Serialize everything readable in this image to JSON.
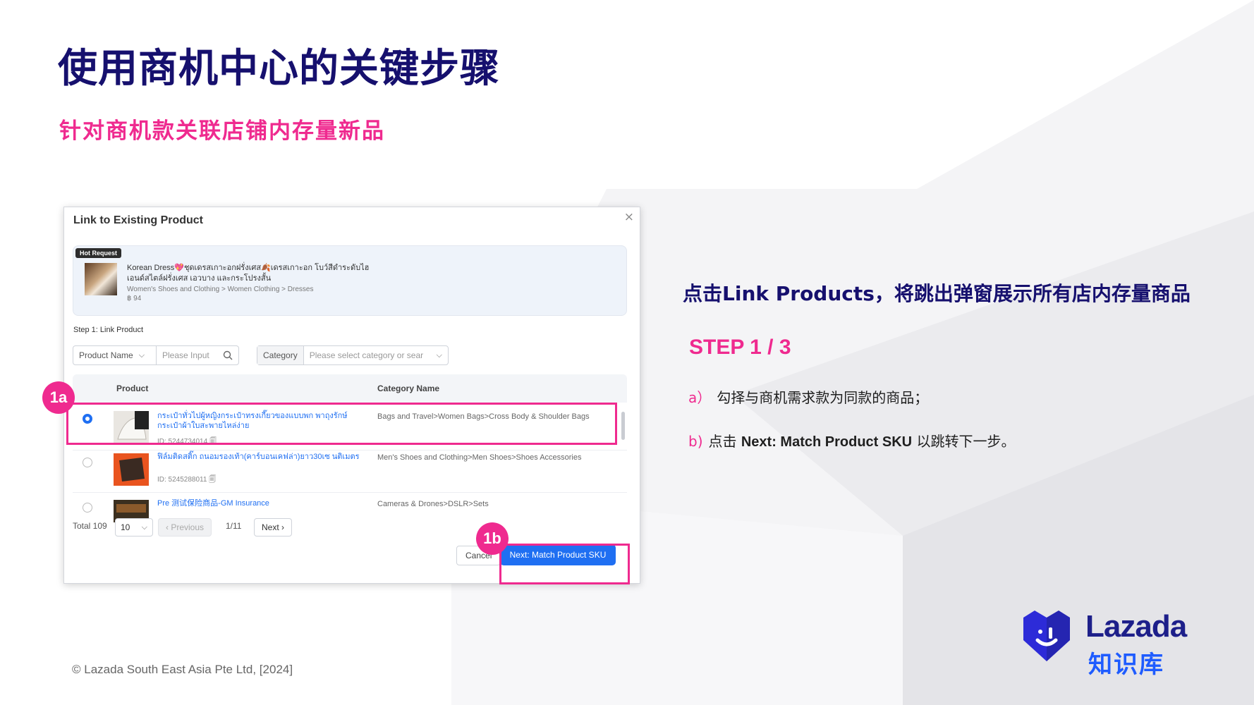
{
  "slide": {
    "title": "使用商机中心的关键步骤",
    "subtitle": "针对商机款关联店铺内存量新品",
    "footer": "© Lazada South East Asia Pte Ltd, [2024]"
  },
  "dialog": {
    "title": "Link to Existing Product",
    "close_icon": "×",
    "hot_request": {
      "badge": "Hot Request",
      "name": "Korean Dress💖ชุดเดรสเกาะอกฝรั่งเศส🍂เดรสเกาะอก โบว์สีดำระดับไฮเอนด์สไตล์ฝรั่งเศส เอวบาง และกระโปรงสั้น",
      "category": "Women's Shoes and Clothing > Women Clothing > Dresses",
      "price": "฿ 94"
    },
    "step_label": "Step 1: Link Product",
    "filters": {
      "field_select": "Product Name",
      "search_placeholder": "Please Input",
      "category_label": "Category",
      "category_placeholder": "Please select category or sear"
    },
    "table": {
      "headers": [
        "Product",
        "Category Name"
      ],
      "rows": [
        {
          "selected": true,
          "name": "กระเป๋าทั่วไปผู้หญิงกระเป๋าทรงเกี๊ยวของแบบพก พาถุงรักษ์กระเป๋าผ้าใบสะพายไหล่ง่าย",
          "id": "ID: 5244734014 🗐",
          "category": "Bags and Travel>Women Bags>Cross Body & Shoulder Bags"
        },
        {
          "selected": false,
          "name": "ฟิล์มติดสติ๊ก ถนอมรองเท้า(คาร์บอนเคฟล่า)ยาว30เซ นติเมตร",
          "id": "ID: 5245288011 🗐",
          "category": "Men's Shoes and Clothing>Men Shoes>Shoes Accessories"
        },
        {
          "selected": false,
          "name": "Pre 测试保险商品-GM Insurance",
          "id": "",
          "category": "Cameras & Drones>DSLR>Sets"
        }
      ]
    },
    "pagination": {
      "total": "Total 109",
      "page_size": "10",
      "previous": "‹ Previous",
      "page_indicator": "1/11",
      "next": "Next ›"
    },
    "cancel_label": "Cancel",
    "next_label": "Next: Match Product SKU"
  },
  "markers": {
    "a": "1a",
    "b": "1b"
  },
  "instructions": {
    "heading": "点击Link Products，将跳出弹窗展示所有店内存量商品",
    "step": "STEP 1 / 3",
    "item_a_label": "a）",
    "item_a_text": "勾择与商机需求款为同款的商品；",
    "item_b_label": "b)",
    "item_b_pre": "点击 ",
    "item_b_bold": "Next: Match Product SKU",
    "item_b_post": " 以跳转下一步。"
  },
  "logo": {
    "word": "Lazada",
    "sub": "知识库"
  },
  "colors": {
    "title": "#16106e",
    "accent_pink": "#ef2a8f",
    "primary_blue": "#1f6ff2",
    "logo_blue": "#1d1f8a"
  },
  "icons": {
    "dialog_close": "close-icon",
    "search": "search-icon",
    "dropdown": "chevron-down-icon",
    "copy": "copy-icon",
    "logo": "lazada-heart-logo"
  }
}
